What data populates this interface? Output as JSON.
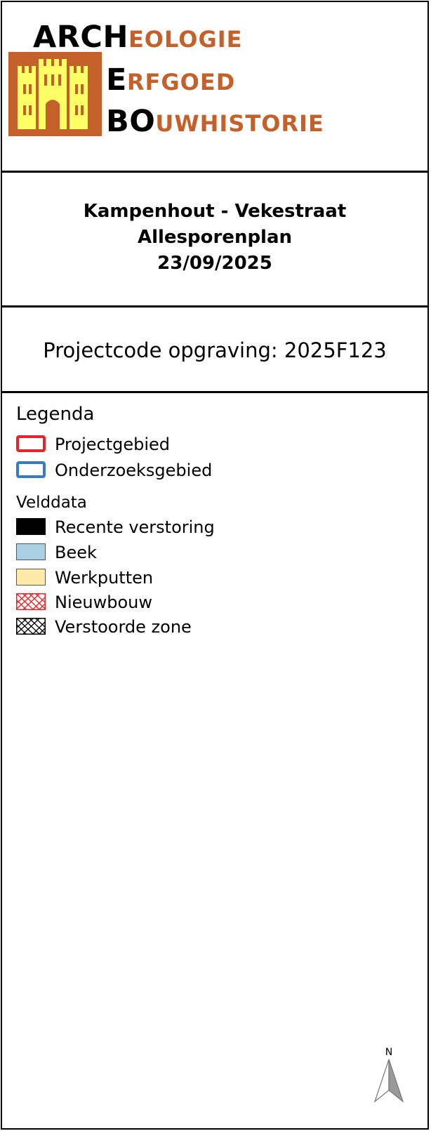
{
  "logo": {
    "lines": [
      {
        "big": "ARCH",
        "small": "EOLOGIE"
      },
      {
        "big": "E",
        "small": "RFGOED"
      },
      {
        "big": "BO",
        "small": "UWHISTORIE"
      }
    ],
    "colors": {
      "emblem": "#c4612a",
      "castle": "#ffff66",
      "text_accent": "#c4612a"
    }
  },
  "title": {
    "location": "Kampenhout - Vekestraat",
    "plan": "Allesporenplan",
    "date": "23/09/2025"
  },
  "project_code": "Projectcode opgraving: 2025F123",
  "legend": {
    "title": "Legenda",
    "boundaries": [
      {
        "label": "Projectgebied",
        "color": "#e8242a",
        "style": "outline"
      },
      {
        "label": "Onderzoeksgebied",
        "color": "#3a7bbf",
        "style": "outline"
      }
    ],
    "fielddata_title": "Velddata",
    "fielddata": [
      {
        "label": "Recente verstoring",
        "fill": "#000000",
        "style": "fill"
      },
      {
        "label": "Beek",
        "fill": "#a9cfe4",
        "style": "fill"
      },
      {
        "label": "Werkputten",
        "fill": "#ffe9a8",
        "style": "fill"
      },
      {
        "label": "Nieuwbouw",
        "color": "#e8242a",
        "style": "crosshatch"
      },
      {
        "label": "Verstoorde zone",
        "color": "#000000",
        "style": "crosshatch"
      }
    ]
  },
  "north_arrow": {
    "label": "N"
  }
}
